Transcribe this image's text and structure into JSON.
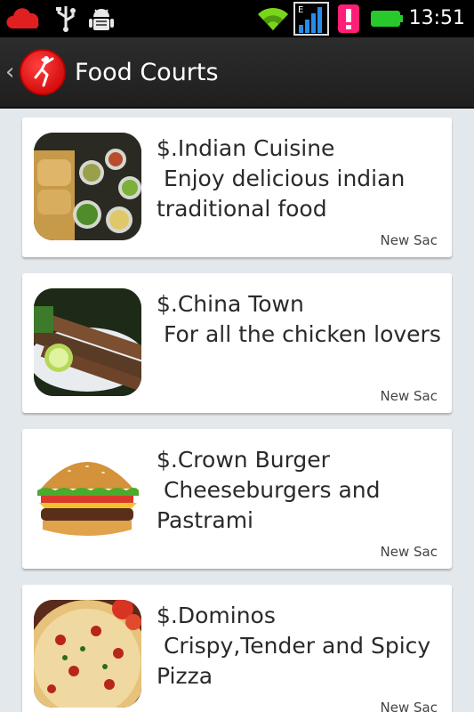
{
  "status_bar": {
    "time": "13:51",
    "network_type": "E",
    "icons": [
      "cloud-icon",
      "usb-icon",
      "android-debug-icon",
      "wifi-icon",
      "signal-icon",
      "alert-icon",
      "battery-icon"
    ],
    "colors": {
      "cloud": "#e02020",
      "wifi": "#7ad61a",
      "signal": "#2a8ce8",
      "alert": "#ff1e78",
      "battery": "#28c92c"
    }
  },
  "action_bar": {
    "title": "Food Courts",
    "back_icon": "chevron-left-icon",
    "logo_icon": "app-logo-icon",
    "logo_color": "#e21b1b"
  },
  "items": [
    {
      "name": "$.Indian Cuisine",
      "description": " Enjoy delicious indian traditional food",
      "location": "New Sac",
      "image": "indian-food-image"
    },
    {
      "name": "$.China Town",
      "description": " For all the chicken lovers",
      "location": "New Sac",
      "image": "chicken-skewers-image"
    },
    {
      "name": "$.Crown Burger",
      "description": " Cheeseburgers and Pastrami",
      "location": "New Sac",
      "image": "burger-image"
    },
    {
      "name": "$.Dominos",
      "description": " Crispy,Tender and Spicy Pizza",
      "location": "New Sac",
      "image": "pizza-image"
    }
  ]
}
